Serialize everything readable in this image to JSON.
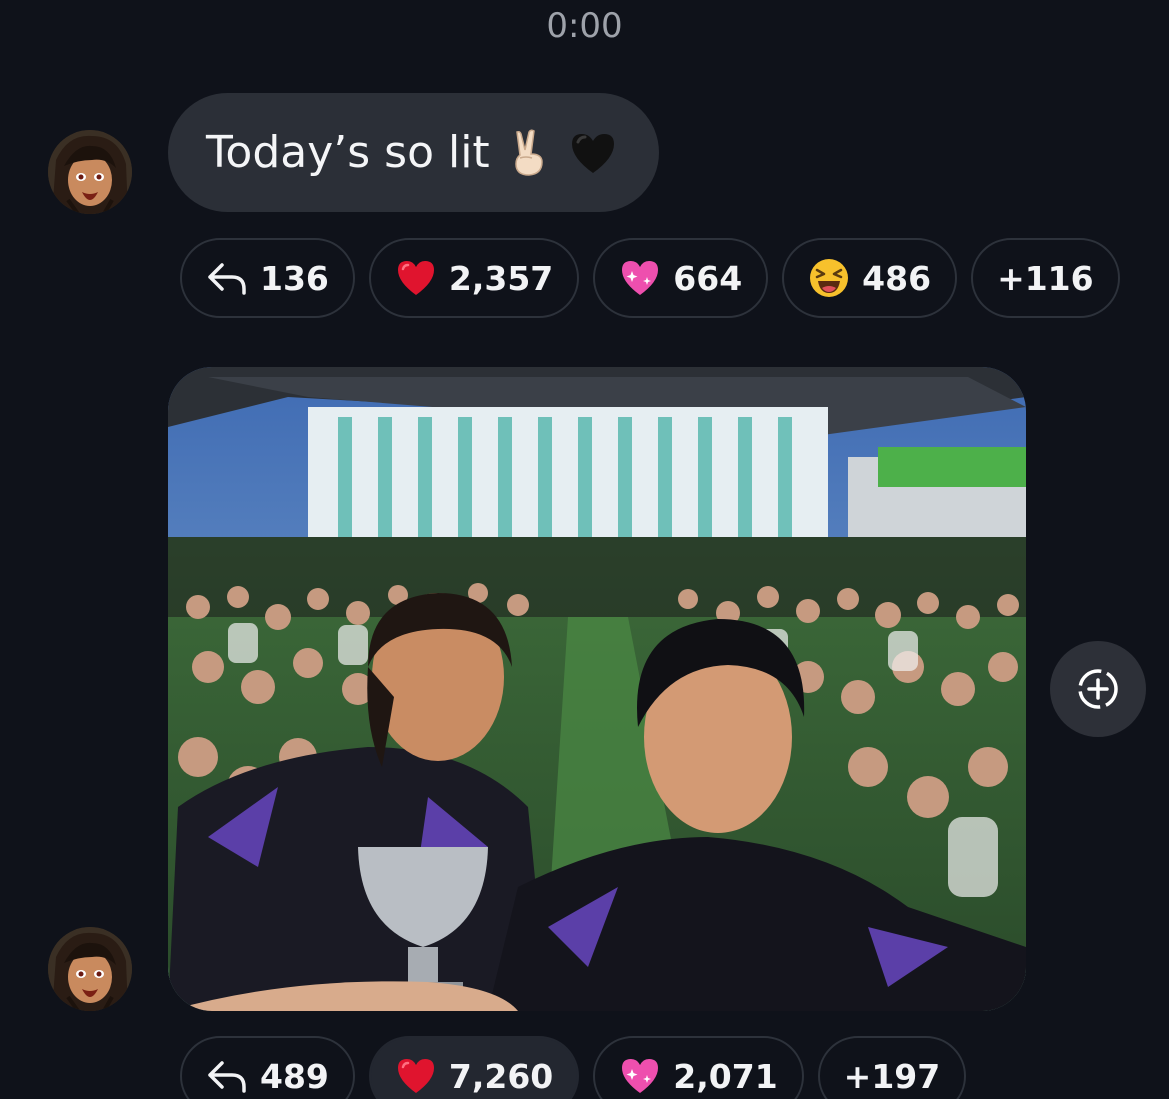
{
  "timestamp": "0:00",
  "message1": {
    "text": "Today’s so lit",
    "emojis": [
      "victory-hand-icon",
      "black-heart-icon"
    ],
    "reactions": {
      "replies": "136",
      "heart": "2,357",
      "sparkling_heart": "664",
      "laughing": "486",
      "more": "+116"
    }
  },
  "message2": {
    "photo": "selfie-with-crowd",
    "reactions": {
      "replies": "489",
      "heart": "7,260",
      "sparkling_heart": "2,071",
      "more": "+197"
    }
  },
  "colors": {
    "background": "#0f121a",
    "bubble": "#2b2f37",
    "pill_border": "#2d323b",
    "active_pill": "#232730",
    "heart": "#e0142e",
    "sparkling_heart": "#ee4fae"
  }
}
